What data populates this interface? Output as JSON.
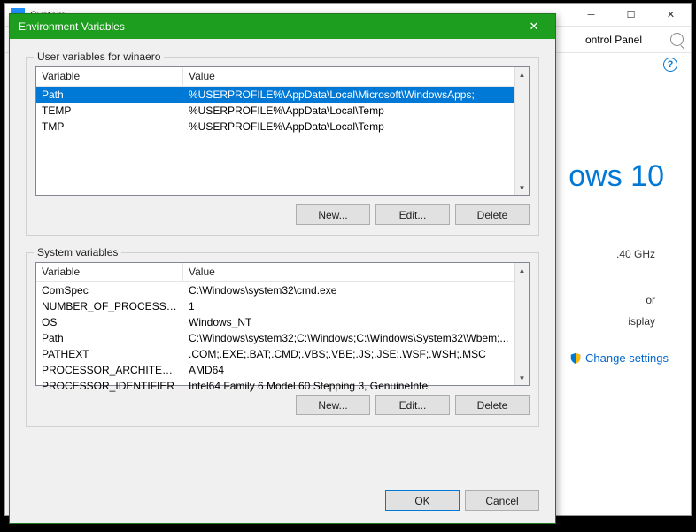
{
  "bgWindow": {
    "title": "System",
    "controlPanelLabel": "ontrol Panel",
    "logoText": "ows 10",
    "cpuHint": ".40 GHz",
    "procHint": "or",
    "displayHint": "isplay",
    "changeSettings": "Change settings"
  },
  "dialog": {
    "title": "Environment Variables",
    "userGroupTitle": "User variables for winaero",
    "sysGroupTitle": "System variables",
    "colVariable": "Variable",
    "colValue": "Value",
    "btnNew": "New...",
    "btnEdit": "Edit...",
    "btnDelete": "Delete",
    "btnOK": "OK",
    "btnCancel": "Cancel"
  },
  "userVars": [
    {
      "name": "Path",
      "value": "%USERPROFILE%\\AppData\\Local\\Microsoft\\WindowsApps;",
      "selected": true
    },
    {
      "name": "TEMP",
      "value": "%USERPROFILE%\\AppData\\Local\\Temp",
      "selected": false
    },
    {
      "name": "TMP",
      "value": "%USERPROFILE%\\AppData\\Local\\Temp",
      "selected": false
    }
  ],
  "sysVars": [
    {
      "name": "ComSpec",
      "value": "C:\\Windows\\system32\\cmd.exe"
    },
    {
      "name": "NUMBER_OF_PROCESSORS",
      "value": "1"
    },
    {
      "name": "OS",
      "value": "Windows_NT"
    },
    {
      "name": "Path",
      "value": "C:\\Windows\\system32;C:\\Windows;C:\\Windows\\System32\\Wbem;..."
    },
    {
      "name": "PATHEXT",
      "value": ".COM;.EXE;.BAT;.CMD;.VBS;.VBE;.JS;.JSE;.WSF;.WSH;.MSC"
    },
    {
      "name": "PROCESSOR_ARCHITECTURE",
      "value": "AMD64"
    },
    {
      "name": "PROCESSOR_IDENTIFIER",
      "value": "Intel64 Family 6 Model 60 Stepping 3, GenuineIntel"
    }
  ]
}
